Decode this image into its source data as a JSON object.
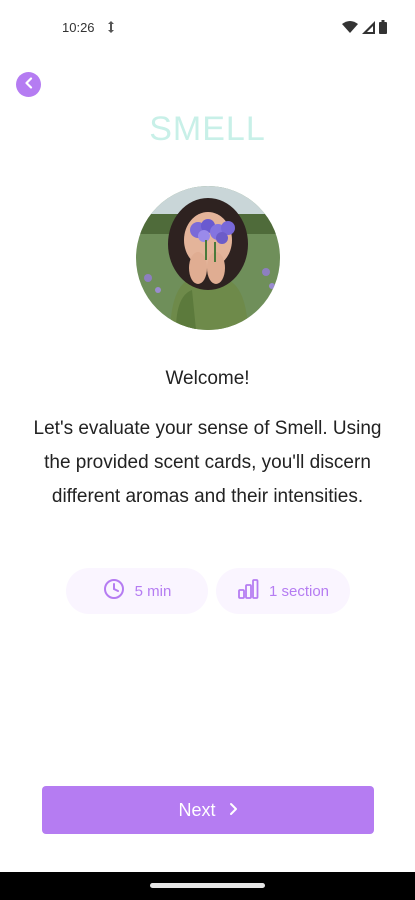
{
  "status_bar": {
    "time": "10:26",
    "icons": [
      "sync-icon",
      "wifi-icon",
      "signal-icon",
      "battery-icon"
    ]
  },
  "header": {
    "back_icon": "chevron-left-icon",
    "title": "SMELL"
  },
  "main": {
    "welcome": "Welcome!",
    "description": "Let's evaluate your sense of Smell. Using the provided scent cards, you'll discern different aromas and their intensities.",
    "chips": {
      "duration": {
        "icon": "clock-icon",
        "label": "5 min"
      },
      "sections": {
        "icon": "bar-chart-icon",
        "label": "1 section"
      }
    }
  },
  "footer": {
    "next_label": "Next",
    "next_icon": "chevron-right-icon"
  },
  "colors": {
    "accent": "#b57cf2",
    "title": "#c8f0e8",
    "chip_bg": "#faf5ff"
  }
}
